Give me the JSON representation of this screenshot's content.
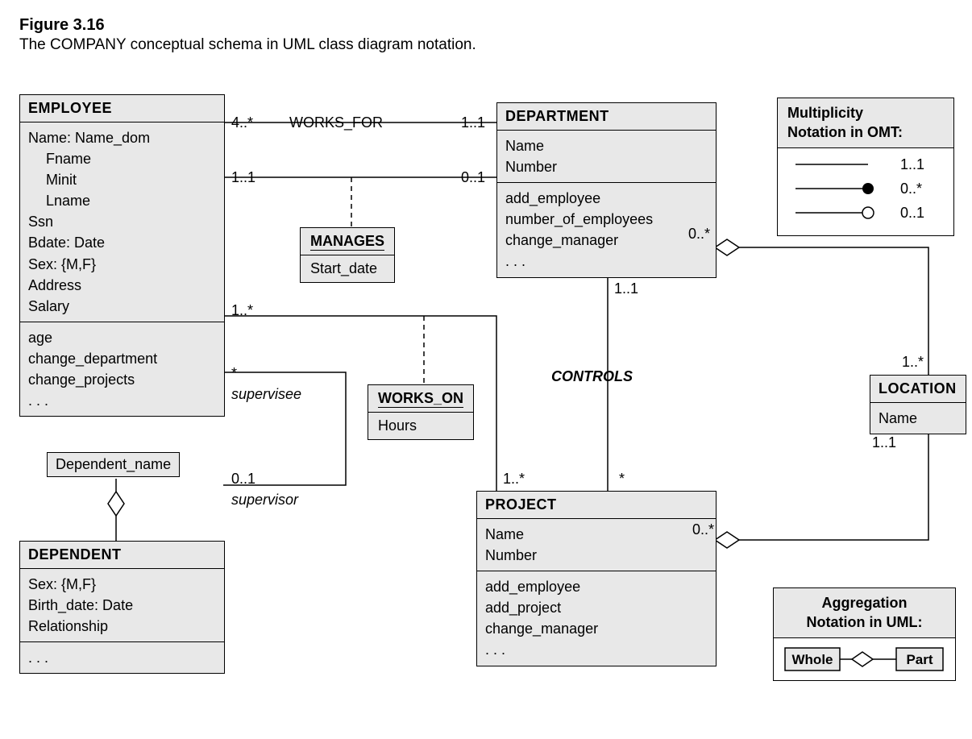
{
  "figure": {
    "number": "Figure 3.16",
    "caption": "The COMPANY conceptual schema in UML class diagram notation."
  },
  "classes": {
    "employee": {
      "name": "EMPLOYEE",
      "attrs": [
        "Name: Name_dom",
        "Fname",
        "Minit",
        "Lname",
        "Ssn",
        "Bdate: Date",
        "Sex: {M,F}",
        "Address",
        "Salary"
      ],
      "ops": [
        "age",
        "change_department",
        "change_projects",
        ". . ."
      ]
    },
    "department": {
      "name": "DEPARTMENT",
      "attrs": [
        "Name",
        "Number"
      ],
      "ops": [
        "add_employee",
        "number_of_employees",
        "change_manager",
        ". . ."
      ]
    },
    "project": {
      "name": "PROJECT",
      "attrs": [
        "Name",
        "Number"
      ],
      "ops": [
        "add_employee",
        "add_project",
        "change_manager",
        ". . ."
      ]
    },
    "dependent": {
      "name": "DEPENDENT",
      "attrs": [
        "Sex: {M,F}",
        "Birth_date: Date",
        "Relationship"
      ],
      "ops": [
        ". . ."
      ]
    },
    "location": {
      "name": "LOCATION",
      "attrs": [
        "Name"
      ]
    }
  },
  "assoc_classes": {
    "manages": {
      "name": "MANAGES",
      "attrs": [
        "Start_date"
      ]
    },
    "works_on": {
      "name": "WORKS_ON",
      "attrs": [
        "Hours"
      ]
    }
  },
  "assoc": {
    "works_for": {
      "name": "WORKS_FOR",
      "left": "4..*",
      "right": "1..1"
    },
    "manages_mult": {
      "left": "1..1",
      "right": "0..1"
    },
    "works_on_mult": {
      "left": "1..*",
      "right": "1..*"
    },
    "controls": {
      "name": "CONTROLS",
      "top": "1..1",
      "bottom": "*"
    },
    "supervision": {
      "supervisee_mult": "*",
      "supervisee_role": "supervisee",
      "supervisor_mult": "0..1",
      "supervisor_role": "supervisor"
    },
    "dept_loc": {
      "dept": "0..*",
      "loc": "1..*"
    },
    "proj_loc": {
      "proj": "0..*",
      "loc": "1..1"
    },
    "dependent_qualifier": "Dependent_name"
  },
  "legends": {
    "omt": {
      "title1": "Multiplicity",
      "title2": "Notation in OMT:",
      "items": [
        "1..1",
        "0..*",
        "0..1"
      ]
    },
    "agg": {
      "title1": "Aggregation",
      "title2": "Notation in UML:",
      "whole": "Whole",
      "part": "Part"
    }
  }
}
